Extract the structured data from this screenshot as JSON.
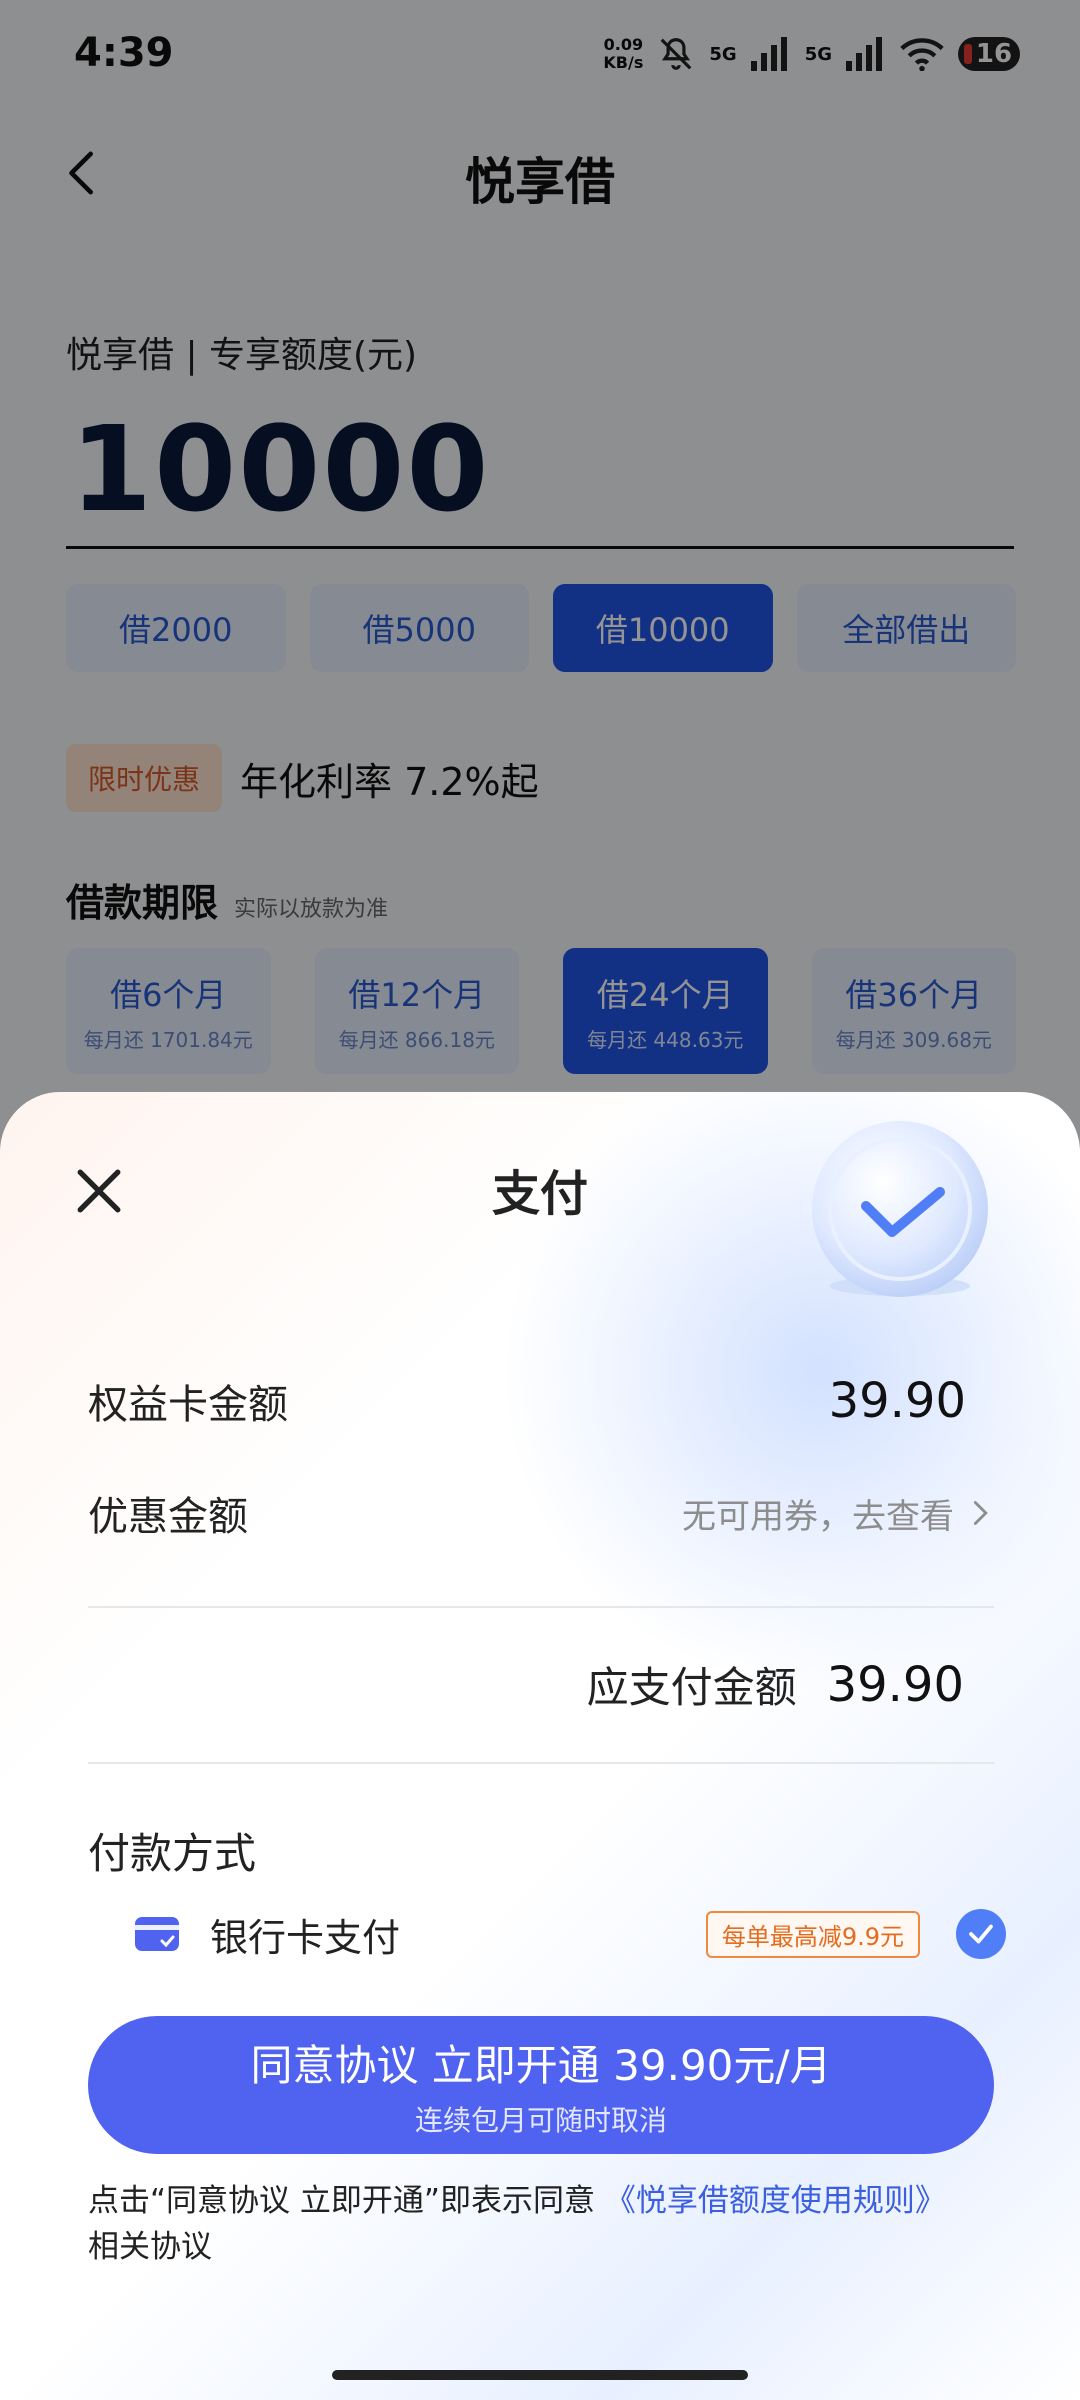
{
  "status_bar": {
    "time": "4:39",
    "net_speed_top": "0.09",
    "net_speed_bottom": "KB/s",
    "sig1_label": "5G",
    "sig2_label": "5G",
    "battery": "16"
  },
  "nav": {
    "title": "悦享借"
  },
  "quota": {
    "label": "悦享借 | 专享额度(元)",
    "amount": "10000"
  },
  "quick_amounts": [
    {
      "label": "借2000"
    },
    {
      "label": "借5000"
    },
    {
      "label": "借10000",
      "selected": true
    },
    {
      "label": "全部借出"
    }
  ],
  "promo": {
    "badge": "限时优惠",
    "text": "年化利率 7.2%起"
  },
  "term": {
    "title": "借款期限",
    "subtitle": "实际以放款为准",
    "options": [
      {
        "label": "借6个月",
        "monthly": "每月还 1701.84元"
      },
      {
        "label": "借12个月",
        "monthly": "每月还 866.18元"
      },
      {
        "label": "借24个月",
        "monthly": "每月还 448.63元",
        "selected": true
      },
      {
        "label": "借36个月",
        "monthly": "每月还 309.68元"
      }
    ]
  },
  "sheet": {
    "title": "支付",
    "card_amount_label": "权益卡金额",
    "card_amount_value": "39.90",
    "discount_label": "优惠金额",
    "discount_value": "无可用券，去查看",
    "due_label": "应支付金额",
    "due_value": "39.90",
    "pay_method_title": "付款方式",
    "pay_method": {
      "label": "银行卡支付",
      "tag": "每单最高减9.9元",
      "selected": true
    },
    "cta_main": "同意协议 立即开通 39.90元/月",
    "cta_sub": "连续包月可随时取消",
    "agree_prefix": "点击“同意协议 立即开通”即表示同意 ",
    "agree_link": "《悦享借额度使用规则》",
    "agree_suffix": "相关协议"
  },
  "colors": {
    "accent": "#4f62f0",
    "selected_blue": "#1f55e6",
    "promo_orange": "#e56c1e"
  }
}
